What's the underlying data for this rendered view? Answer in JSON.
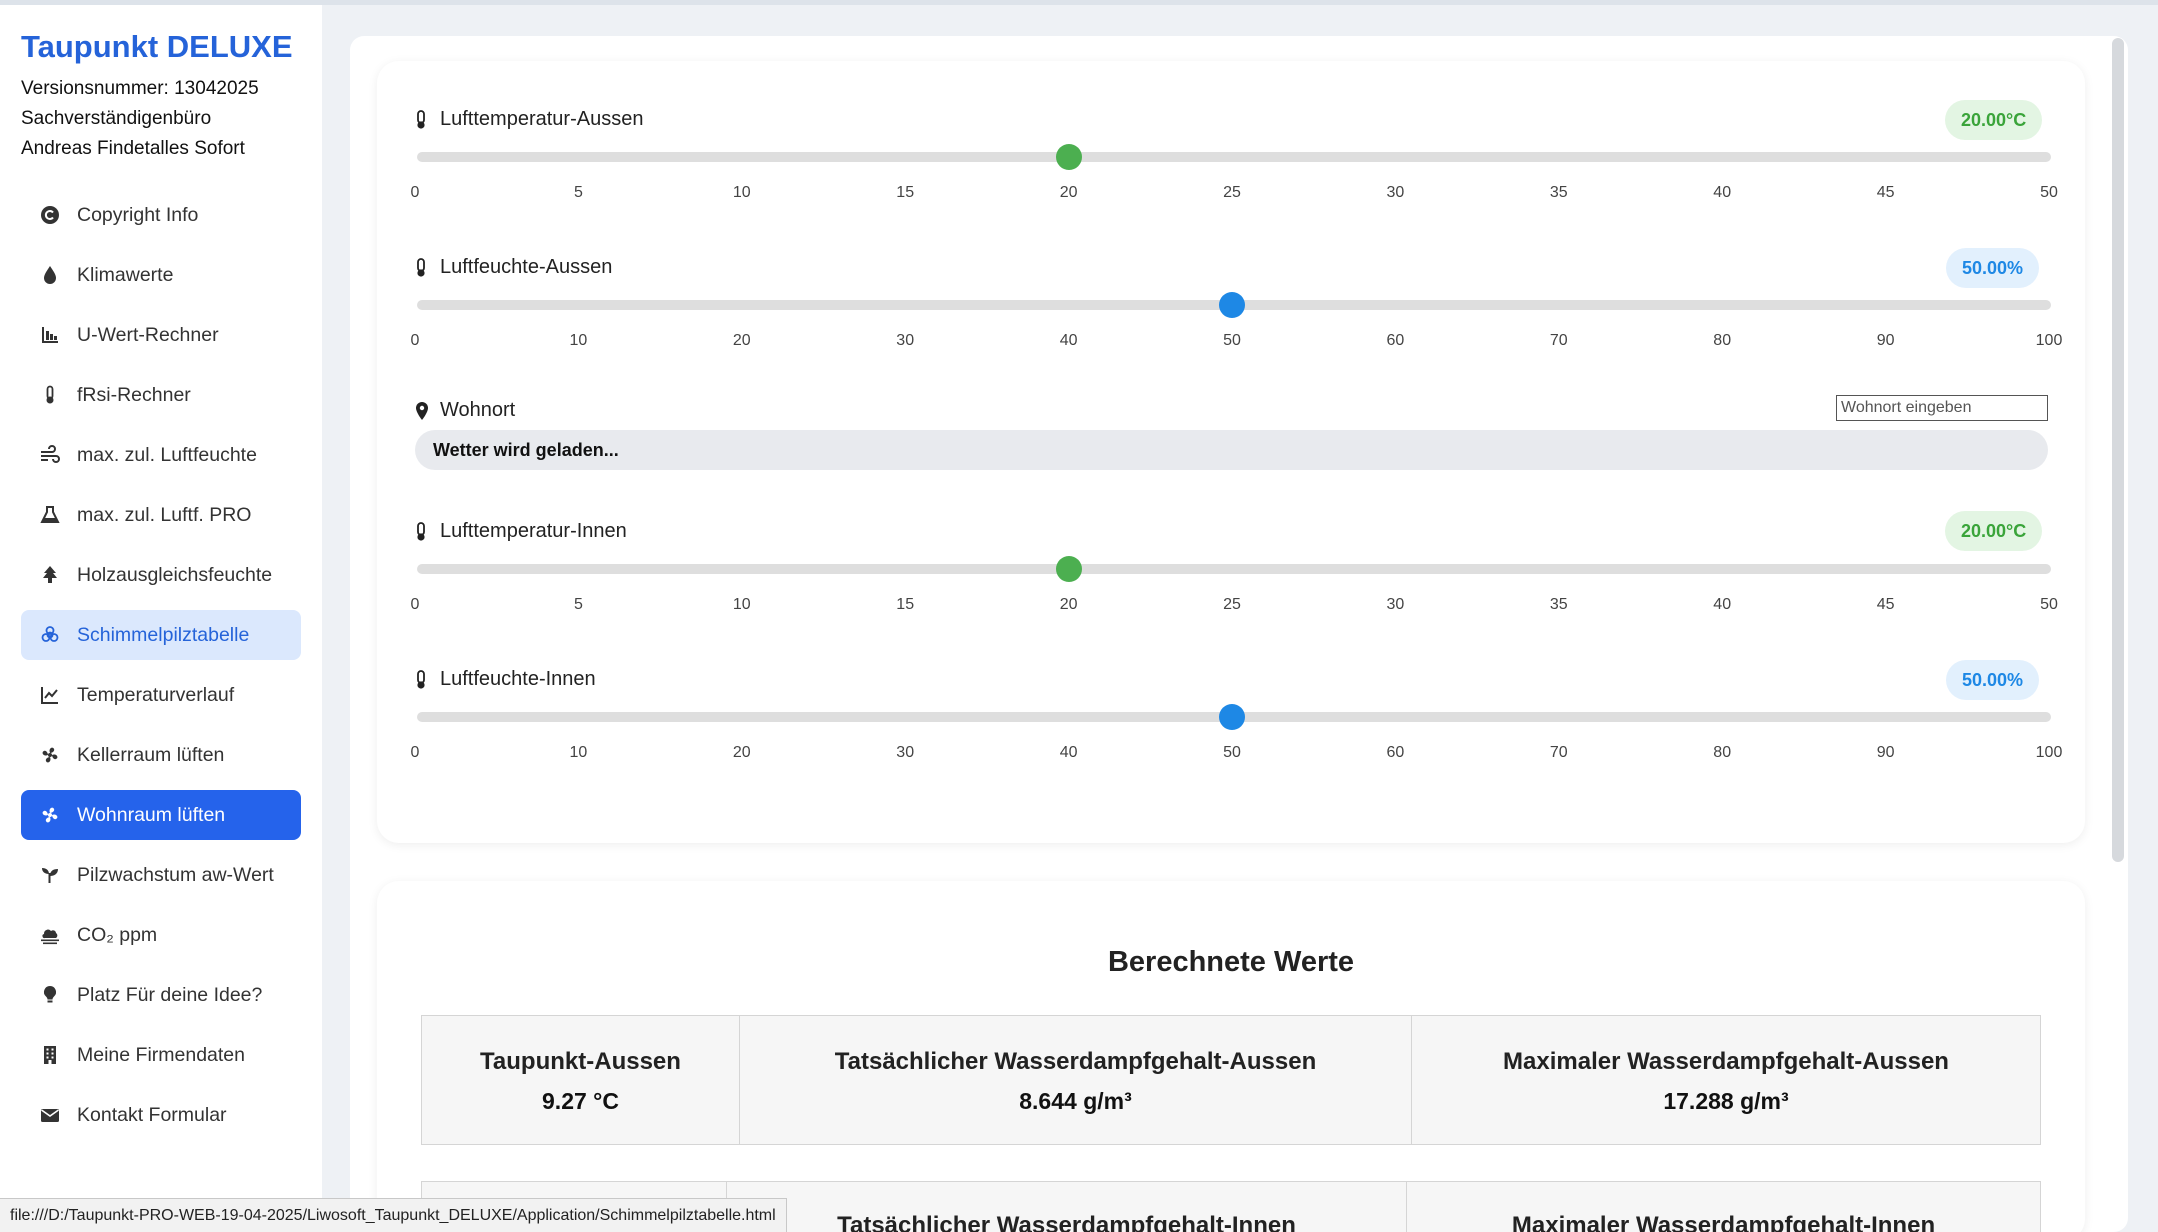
{
  "sidebar": {
    "brand": "Taupunkt DELUXE",
    "version": "Versionsnummer: 13042025",
    "office": "Sachverständigenbüro",
    "owner": "Andreas Findetalles Sofort",
    "items": [
      {
        "label": "Copyright Info",
        "icon": "copyright-icon"
      },
      {
        "label": "Klimawerte",
        "icon": "droplet-icon"
      },
      {
        "label": "U-Wert-Rechner",
        "icon": "chart-bar-icon"
      },
      {
        "label": "fRsi-Rechner",
        "icon": "thermometer-icon"
      },
      {
        "label": "max. zul. Luftfeuchte",
        "icon": "wind-icon"
      },
      {
        "label": "max. zul. Luftf. PRO",
        "icon": "flask-icon"
      },
      {
        "label": "Holzausgleichsfeuchte",
        "icon": "tree-icon"
      },
      {
        "label": "Schimmelpilztabelle",
        "icon": "biohazard-icon"
      },
      {
        "label": "Temperaturverlauf",
        "icon": "line-chart-icon"
      },
      {
        "label": "Kellerraum lüften",
        "icon": "fan-icon"
      },
      {
        "label": "Wohnraum lüften",
        "icon": "fan-icon"
      },
      {
        "label": "Pilzwachstum aw-Wert",
        "icon": "seedling-icon"
      },
      {
        "label": "CO₂ ppm",
        "icon": "smog-icon"
      },
      {
        "label": "Platz Für deine Idee?",
        "icon": "lightbulb-icon"
      },
      {
        "label": "Meine Firmendaten",
        "icon": "building-icon"
      },
      {
        "label": "Kontakt Formular",
        "icon": "envelope-icon"
      }
    ]
  },
  "sliders": {
    "temp_aussen": {
      "label": "Lufttemperatur-Aussen",
      "value_text": "20.00°C",
      "value": 20,
      "min": 0,
      "max": 50,
      "ticks": [
        "0",
        "5",
        "10",
        "15",
        "20",
        "25",
        "30",
        "35",
        "40",
        "45",
        "50"
      ]
    },
    "feuchte_aussen": {
      "label": "Luftfeuchte-Aussen",
      "value_text": "50.00%",
      "value": 50,
      "min": 0,
      "max": 100,
      "ticks": [
        "0",
        "10",
        "20",
        "30",
        "40",
        "50",
        "60",
        "70",
        "80",
        "90",
        "100"
      ]
    },
    "temp_innen": {
      "label": "Lufttemperatur-Innen",
      "value_text": "20.00°C",
      "value": 20,
      "min": 0,
      "max": 50,
      "ticks": [
        "0",
        "5",
        "10",
        "15",
        "20",
        "25",
        "30",
        "35",
        "40",
        "45",
        "50"
      ]
    },
    "feuchte_innen": {
      "label": "Luftfeuchte-Innen",
      "value_text": "50.00%",
      "value": 50,
      "min": 0,
      "max": 100,
      "ticks": [
        "0",
        "10",
        "20",
        "30",
        "40",
        "50",
        "60",
        "70",
        "80",
        "90",
        "100"
      ]
    }
  },
  "wohnort": {
    "label": "Wohnort",
    "placeholder": "Wohnort eingeben",
    "weather": "Wetter wird geladen..."
  },
  "results": {
    "title": "Berechnete Werte",
    "row1": [
      {
        "label": "Taupunkt-Aussen",
        "value": "9.27 °C"
      },
      {
        "label": "Tatsächlicher Wasserdampfgehalt-Aussen",
        "value": "8.644 g/m³"
      },
      {
        "label": "Maximaler Wasserdampfgehalt-Aussen",
        "value": "17.288 g/m³"
      }
    ],
    "row2": [
      {
        "label": ""
      },
      {
        "label": "Tatsächlicher Wasserdampfgehalt-Innen"
      },
      {
        "label": "Maximaler Wasserdampfgehalt-Innen"
      }
    ]
  },
  "status": {
    "url": "file:///D:/Taupunkt-PRO-WEB-19-04-2025/Liwosoft_Taupunkt_DELUXE/Application/Schimmelpilztabelle.html"
  },
  "colors": {
    "accent": "#2563eb",
    "temp_thumb": "#4caf50",
    "humidity_thumb": "#1e88e5"
  }
}
